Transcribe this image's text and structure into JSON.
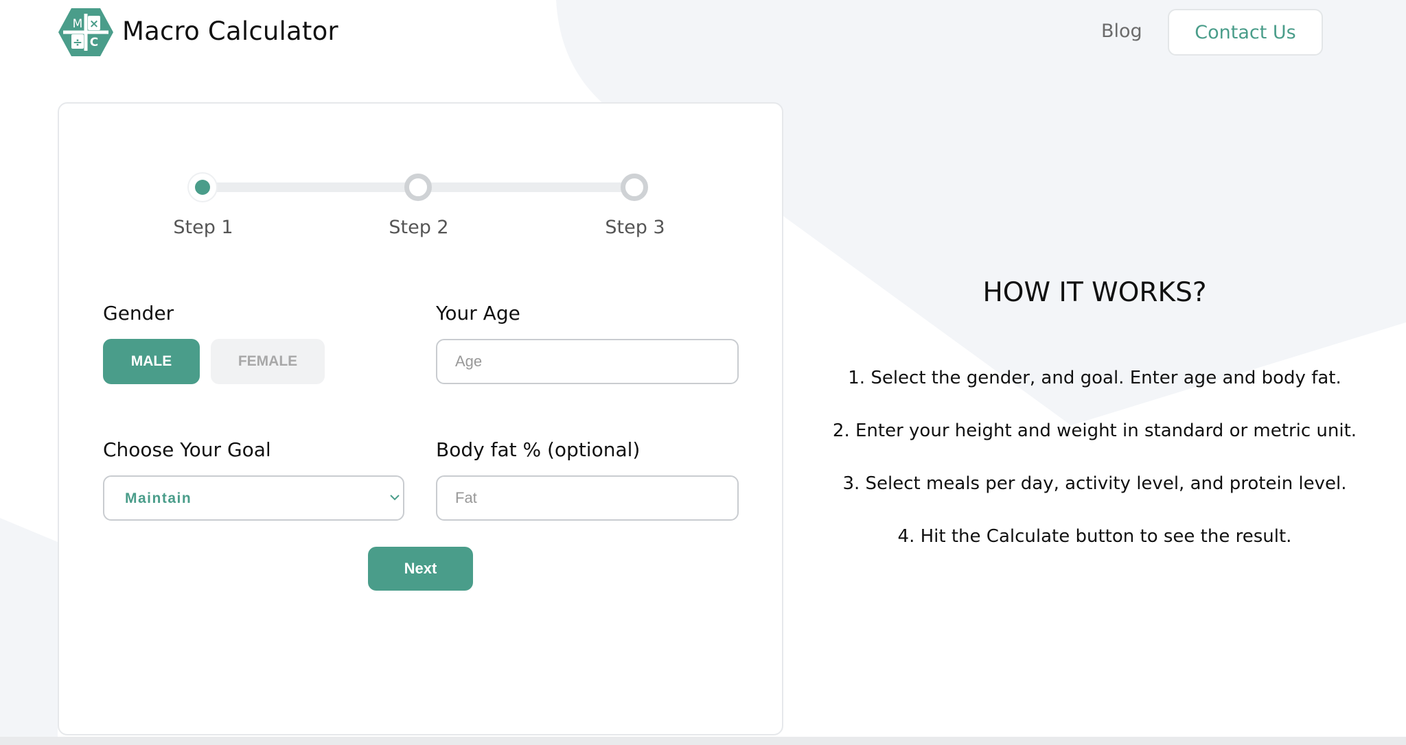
{
  "header": {
    "logo_cells": [
      "M",
      "×",
      "÷",
      "C"
    ],
    "brand": "Macro Calculator",
    "nav_blog": "Blog",
    "contact_button": "Contact Us"
  },
  "stepper": {
    "steps": [
      {
        "label": "Step 1",
        "state": "active"
      },
      {
        "label": "Step 2",
        "state": "inactive"
      },
      {
        "label": "Step 3",
        "state": "inactive"
      }
    ]
  },
  "form": {
    "gender": {
      "label": "Gender",
      "options": [
        "MALE",
        "FEMALE"
      ],
      "selected": "MALE"
    },
    "age": {
      "label": "Your Age",
      "placeholder": "Age",
      "value": ""
    },
    "goal": {
      "label": "Choose Your Goal",
      "selected": "Maintain"
    },
    "body_fat": {
      "label": "Body fat % (optional)",
      "placeholder": "Fat",
      "value": ""
    },
    "next_button": "Next"
  },
  "how_it_works": {
    "title": "HOW IT WORKS?",
    "steps": [
      "1. Select the gender, and goal. Enter age and body fat.",
      "2. Enter your height and weight in standard or metric unit.",
      "3. Select meals per day, activity level, and protein level.",
      "4. Hit the Calculate button to see the result."
    ]
  },
  "colors": {
    "accent": "#4a9d8a",
    "background_shape": "#f3f5f8",
    "inactive_button_bg": "#f1f2f3",
    "inactive_step": "#cfd2d5",
    "border": "#c9ccd0"
  },
  "icons": {
    "logo": "macro-calculator-hexagon-logo",
    "select_arrow": "chevron-down-icon"
  }
}
